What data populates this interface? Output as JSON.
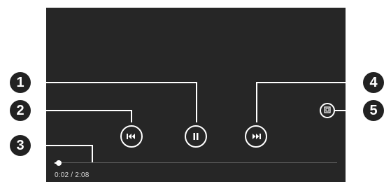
{
  "player": {
    "current_time": "0:02",
    "separator": "/",
    "duration": "2:08",
    "progress_fraction": 0.0156
  },
  "controls": {
    "previous_icon": "skip-previous-icon",
    "play_pause_icon": "pause-icon",
    "next_icon": "skip-next-icon",
    "fullscreen_icon": "fullscreen-icon"
  },
  "callouts": [
    {
      "number": "1"
    },
    {
      "number": "2"
    },
    {
      "number": "3"
    },
    {
      "number": "4"
    },
    {
      "number": "5"
    }
  ],
  "colors": {
    "player_background": "#262626",
    "control_foreground": "#ffffff",
    "callout_badge": "#222222"
  }
}
